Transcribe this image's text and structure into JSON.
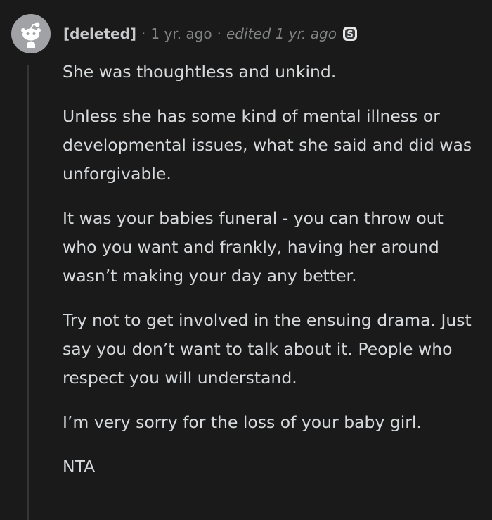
{
  "comment": {
    "author": "[deleted]",
    "separator": "·",
    "posted_time": "1 yr. ago",
    "edited_label": "edited 1 yr. ago",
    "award_icon": "silver-s-award-icon",
    "paragraphs": [
      "She was thoughtless and unkind.",
      "Unless she has some kind of mental illness or developmental issues, what she said and did was unforgivable.",
      "It was your babies funeral - you can throw out who you want and frankly, having her around wasn’t making your day any better.",
      "Try not to get involved in the ensuing drama. Just say you don’t want to talk about it. People who respect you will understand.",
      "I’m very sorry for the loss of your baby girl.",
      "NTA"
    ]
  },
  "colors": {
    "background": "#1a1a1b",
    "text": "#d7dadc",
    "meta": "#818384",
    "thread_line": "#343536",
    "avatar": "#a0a2a5"
  }
}
